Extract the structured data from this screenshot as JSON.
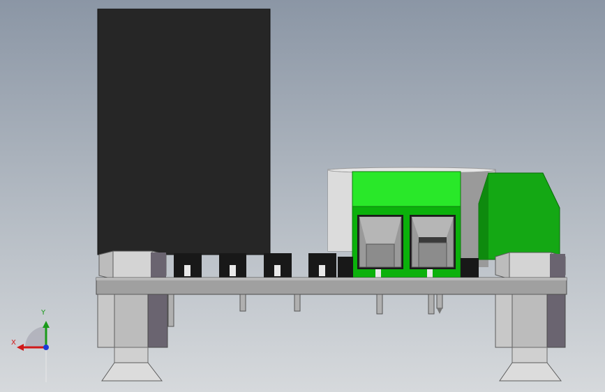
{
  "scene": {
    "colors": {
      "background_top": "#8b96a5",
      "background_bottom": "#d6d9dc",
      "transformer": "#262626",
      "pcb": "#a0a0a0",
      "terminal_green": "#29e829",
      "terminal_dark_green": "#0bb10b",
      "connector_green": "#14a814",
      "capacitor_gray": "#c4c4c4",
      "nut_gray": "#bcbcbc",
      "nut_shadow": "#6a6470",
      "pin_header": "#181818"
    }
  },
  "axes": {
    "x_label": "X",
    "y_label": "Y",
    "x_color": "#d01818",
    "y_color": "#1a9a1a",
    "origin_color": "#1a3ad8"
  }
}
